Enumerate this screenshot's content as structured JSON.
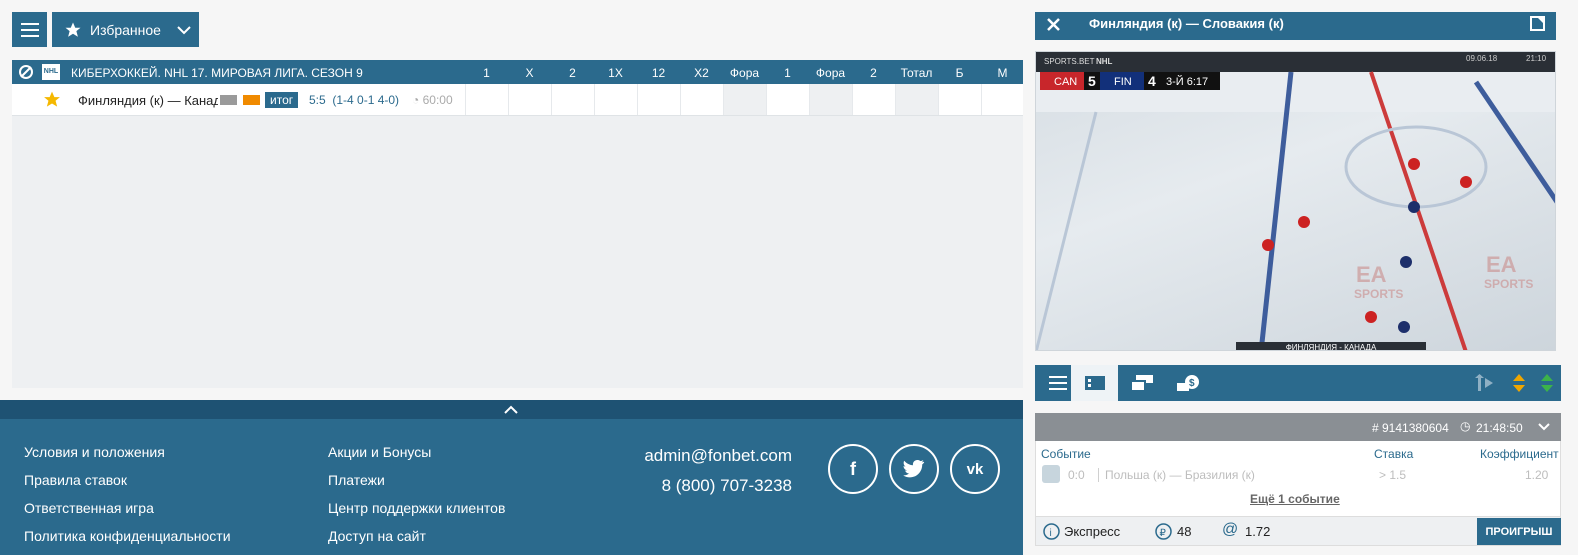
{
  "favorites_label": "Избранное",
  "league": {
    "title": "КИБЕРХОККЕЙ. NHL 17. МИРОВАЯ ЛИГА. СЕЗОН 9",
    "columns": [
      "1",
      "X",
      "2",
      "1X",
      "12",
      "X2",
      "Фора",
      "1",
      "Фора",
      "2",
      "Тотал",
      "Б",
      "М"
    ]
  },
  "event": {
    "name": "Финляндия (к) — Канада (к)",
    "status": "итог",
    "score": "5:5",
    "periods": "(1-4 0-1 4-0)",
    "time": "60:00"
  },
  "footer": {
    "links_col1": [
      "Условия и положения",
      "Правила ставок",
      "Ответственная игра",
      "Политика конфиденциальности"
    ],
    "links_col2": [
      "Акции и Бонусы",
      "Платежи",
      "Центр поддержки клиентов",
      "Доступ на сайт"
    ],
    "email": "admin@fonbet.com",
    "phone": "8 (800) 707-3238"
  },
  "video": {
    "title": "Финляндия (к) — Словакия (к)",
    "team1": "CAN",
    "score1": "5",
    "team2": "FIN",
    "score2": "4",
    "period_clock": "3-Й 6:17",
    "date": "09.06.18",
    "clock": "21:10",
    "caption": "ФИНЛЯНДИЯ - КАНАДА",
    "broadcaster": "SPORTS.BET",
    "ice_brand": "SPORTS"
  },
  "bet_slip": {
    "bet_number": "# 9141380604",
    "time": "21:48:50",
    "col_event": "Событие",
    "col_stake": "Ставка",
    "col_coef": "Коэффициент",
    "item_score": "0:0",
    "item_event": "Польша (к) — Бразилия (к)",
    "item_stake": "> 1.5",
    "item_coef": "1.20",
    "more_events": "Ещё 1 событие",
    "type": "Экспресс",
    "amount": "48",
    "total_coef": "1.72",
    "result": "ПРОИГРЫШ"
  }
}
